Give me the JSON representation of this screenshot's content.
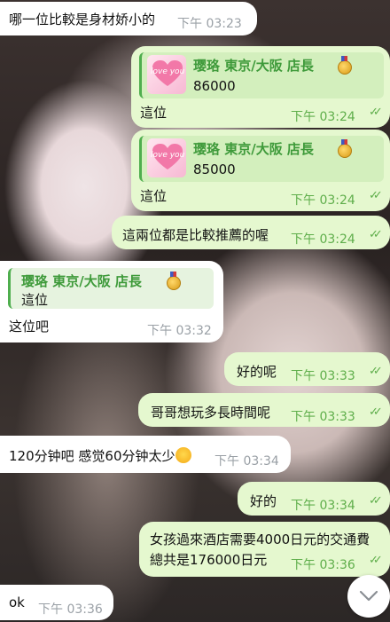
{
  "messages": [
    {
      "id": "m1",
      "dir": "in",
      "text": "哪一位比較是身材娇小的",
      "time": "下午 03:23"
    },
    {
      "id": "m2",
      "dir": "out",
      "quote": {
        "name": "璎珞 東京/大阪 店長",
        "thumb": "love you",
        "text": "86000"
      },
      "text": "這位",
      "time": "下午 03:24"
    },
    {
      "id": "m3",
      "dir": "out",
      "quote": {
        "name": "璎珞 東京/大阪 店長",
        "thumb": "love you",
        "text": "85000"
      },
      "text": "這位",
      "time": "下午 03:24"
    },
    {
      "id": "m4",
      "dir": "out",
      "text": "這兩位都是比較推薦的喔",
      "time": "下午 03:24"
    },
    {
      "id": "m5",
      "dir": "in",
      "quote": {
        "name": "璎珞 東京/大阪 店長",
        "text": "這位"
      },
      "text": "这位吧",
      "time": "下午 03:32"
    },
    {
      "id": "m6",
      "dir": "out",
      "text": "好的呢",
      "time": "下午 03:33"
    },
    {
      "id": "m7",
      "dir": "out",
      "text": "哥哥想玩多長時間呢",
      "time": "下午 03:33"
    },
    {
      "id": "m8",
      "dir": "in",
      "text": "120分钟吧 感觉60分钟太少",
      "time": "下午 03:34",
      "emoji": "laughing-emoji"
    },
    {
      "id": "m9",
      "dir": "out",
      "text": "好的",
      "time": "下午 03:34"
    },
    {
      "id": "m10",
      "dir": "out",
      "text_line1": "女孩過來酒店需要4000日元的交通費",
      "text_line2": "總共是176000日元",
      "time": "下午 03:36"
    },
    {
      "id": "m11",
      "dir": "in",
      "text": "ok",
      "time": "下午 03:36"
    }
  ],
  "icons": {
    "read_receipt": "double-check-icon",
    "medal": "medal-icon",
    "scroll": "chevron-down-icon"
  },
  "colors": {
    "incoming": "#ffffff",
    "outgoing": "#e5f8cf",
    "accent": "#4fae4e"
  }
}
